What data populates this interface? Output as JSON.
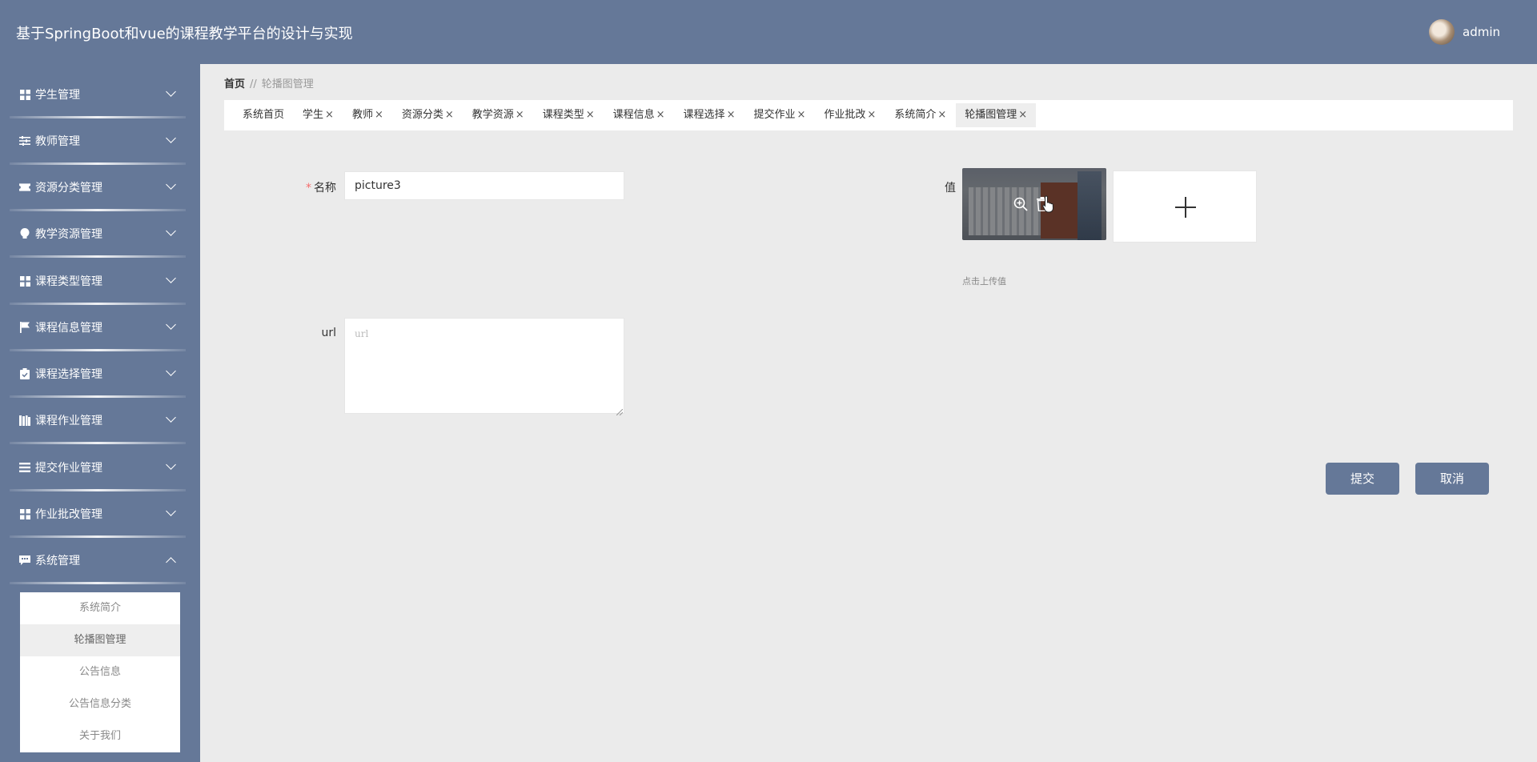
{
  "header": {
    "title": "基于SpringBoot和vue的课程教学平台的设计与实现",
    "user_name": "admin"
  },
  "sidebar": {
    "items": [
      {
        "label": "学生管理",
        "icon": "grid-icon"
      },
      {
        "label": "教师管理",
        "icon": "sliders-icon"
      },
      {
        "label": "资源分类管理",
        "icon": "ticket-icon"
      },
      {
        "label": "教学资源管理",
        "icon": "bulb-icon"
      },
      {
        "label": "课程类型管理",
        "icon": "grid-icon"
      },
      {
        "label": "课程信息管理",
        "icon": "flag-icon"
      },
      {
        "label": "课程选择管理",
        "icon": "clipboard-icon"
      },
      {
        "label": "课程作业管理",
        "icon": "books-icon"
      },
      {
        "label": "提交作业管理",
        "icon": "list-icon"
      },
      {
        "label": "作业批改管理",
        "icon": "grid-icon"
      },
      {
        "label": "系统管理",
        "icon": "chat-icon"
      }
    ],
    "submenu": [
      "系统简介",
      "轮播图管理",
      "公告信息",
      "公告信息分类",
      "关于我们"
    ]
  },
  "breadcrumb": {
    "home": "首页",
    "sep": "//",
    "current": "轮播图管理"
  },
  "tabs": [
    "系统首页",
    "学生",
    "教师",
    "资源分类",
    "教学资源",
    "课程类型",
    "课程信息",
    "课程选择",
    "提交作业",
    "作业批改",
    "系统简介",
    "轮播图管理"
  ],
  "form": {
    "name_label": "名称",
    "required_mark": "*",
    "name_value": "picture3",
    "value_label": "值",
    "upload_hint": "点击上传值",
    "url_label": "url",
    "url_placeholder": "url",
    "submit_label": "提交",
    "cancel_label": "取消"
  },
  "colors": {
    "primary": "#657898",
    "background": "#ebebeb"
  }
}
